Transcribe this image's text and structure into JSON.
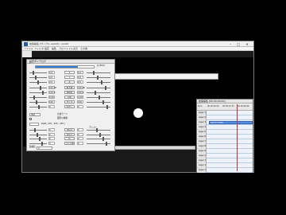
{
  "main_window": {
    "title": "拡張編集 [サンプル.exedit] - AviUtl",
    "controls": {
      "minimize": "–",
      "maximize": "□",
      "close": "✕"
    },
    "menu": [
      "ファイル",
      "フィルタ",
      "設定",
      "編集",
      "プロファイル",
      "表示",
      "その他"
    ]
  },
  "settings": {
    "title": "設定ダイアログ",
    "frame_value": "1",
    "frame_progress": 0.72,
    "frame_end": "[1/300]",
    "rows": [
      {
        "left": "0.0",
        "btn": "X",
        "right": "0.0"
      },
      {
        "left": "0.0",
        "btn": "Y",
        "right": "0.0"
      },
      {
        "left": "0.0",
        "btn": "Z",
        "right": "0.0"
      },
      {
        "left": "100.00",
        "btn": "拡大率",
        "right": "100.00"
      },
      {
        "left": "100.0",
        "btn": "透明度",
        "right": "100.0"
      },
      {
        "left": "0.00",
        "btn": "回転",
        "right": "0.00"
      },
      {
        "left": "100",
        "btn": "サイズ",
        "right": "100"
      },
      {
        "left": "0",
        "btn": "ぼかし",
        "right": "0"
      }
    ],
    "blend_label": "通常",
    "blend_option": "合成モード",
    "figure_label": "図形の種類",
    "color_label": "RGB ( 255 , 255 , 255 )",
    "lower_rows": [
      {
        "left": "0",
        "btn": "中心X",
        "right": "0"
      },
      {
        "left": "0",
        "btn": "中心Y",
        "right": "0"
      },
      {
        "left": "0",
        "btn": "色",
        "right": "0"
      },
      {
        "left": "0",
        "btn": "ライン幅",
        "right": "0"
      }
    ],
    "anchor_label": "アンカー",
    "bottom_label": "縦横比",
    "bottom_field": "0"
  },
  "timeline": {
    "title": "拡張編集 [00:00:00.00]",
    "scale_label": "Root",
    "times": [
      "00:00:00.00",
      "00:00:03.33",
      "00:00:06.66"
    ],
    "layers": [
      "Layer 1",
      "Layer 2",
      "Layer 3",
      "Layer 4",
      "Layer 5",
      "Layer 6",
      "Layer 7",
      "Layer 8",
      "Layer 9",
      "Layer 10",
      "Layer 11",
      "Layer 12",
      "Layer 13"
    ],
    "object_label": "図形[標準描画]",
    "object_layer": 3
  },
  "colors": {
    "accent": "#2f7fd8",
    "object": "#5b8fe0",
    "cursor": "#c03030"
  }
}
